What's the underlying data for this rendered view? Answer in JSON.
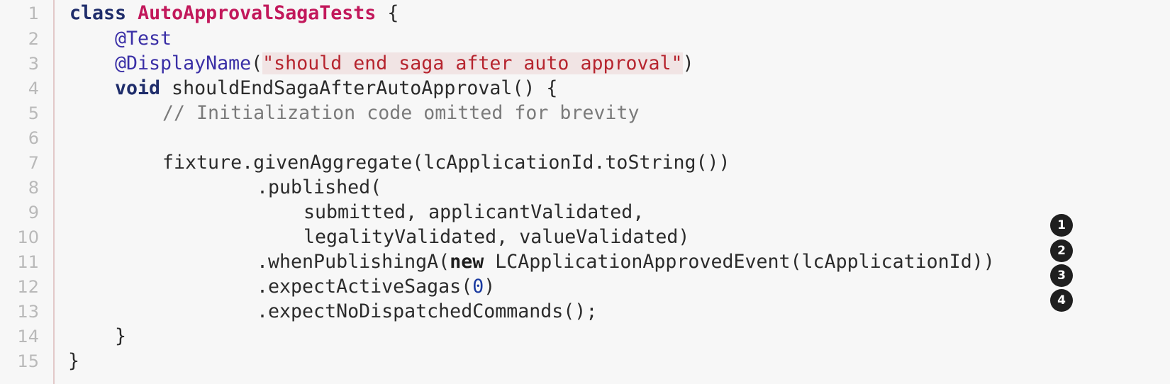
{
  "line_numbers": [
    "1",
    "2",
    "3",
    "4",
    "5",
    "6",
    "7",
    "8",
    "9",
    "10",
    "11",
    "12",
    "13",
    "14",
    "15"
  ],
  "code": {
    "l1_kw": "class",
    "l1_cls": "AutoApprovalSagaTests",
    "l1_rest": " {",
    "l2_ann": "@Test",
    "l3_ann": "@DisplayName",
    "l3_open": "(",
    "l3_str": "\"should end saga after auto approval\"",
    "l3_close": ")",
    "l4_kw": "void",
    "l4_rest": " shouldEndSagaAfterAutoApproval() {",
    "l5_comment": "// Initialization code omitted for brevity",
    "l7": "fixture.givenAggregate(lcApplicationId.toString())",
    "l8": ".published(",
    "l9": "submitted, applicantValidated,",
    "l10": "legalityValidated, valueValidated)",
    "l11_pre": ".whenPublishingA(",
    "l11_kw": "new",
    "l11_rest": " LCApplicationApprovedEvent(lcApplicationId))",
    "l12_pre": ".expectActiveSagas(",
    "l12_num": "0",
    "l12_post": ")",
    "l13": ".expectNoDispatchedCommands();",
    "l14": "}",
    "l15": "}"
  },
  "callouts": [
    "1",
    "2",
    "3",
    "4"
  ]
}
